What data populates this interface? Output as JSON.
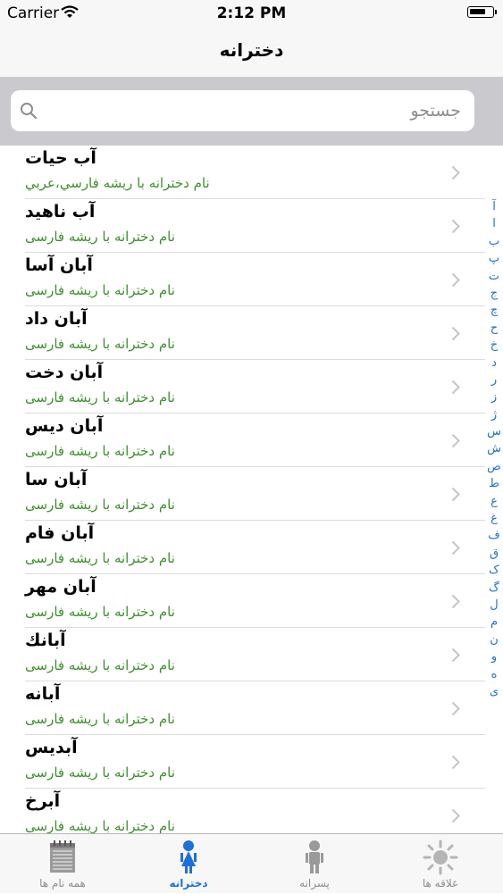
{
  "status": {
    "carrier": "Carrier",
    "time": "2:12 PM"
  },
  "nav": {
    "title": "دخترانه"
  },
  "search": {
    "placeholder": "جستجو"
  },
  "rows": [
    {
      "name": "آب حیات",
      "desc": "نام دخترانه با ریشه فارسي،عربي"
    },
    {
      "name": "آب ناهید",
      "desc": "نام دخترانه با ریشه فارسی"
    },
    {
      "name": "آبان آسا",
      "desc": "نام دخترانه با ریشه فارسی"
    },
    {
      "name": "آبان داد",
      "desc": "نام دخترانه با ریشه فارسی"
    },
    {
      "name": "آبان دخت",
      "desc": "نام دخترانه با ریشه فارسی"
    },
    {
      "name": "آبان دیس",
      "desc": "نام دخترانه با ریشه فارسی"
    },
    {
      "name": "آبان سا",
      "desc": "نام دخترانه با ریشه فارسی"
    },
    {
      "name": "آبان فام",
      "desc": "نام دخترانه با ریشه فارسی"
    },
    {
      "name": "آبان مهر",
      "desc": "نام دخترانه با ریشه فارسی"
    },
    {
      "name": "آبانك",
      "desc": "نام دخترانه با ریشه فارسی"
    },
    {
      "name": "آبانه",
      "desc": "نام دخترانه با ریشه فارسی"
    },
    {
      "name": "آبدیس",
      "desc": "نام دخترانه با ریشه فارسی"
    },
    {
      "name": "آبرخ",
      "desc": "نام دخترانه با ریشه فارسی"
    }
  ],
  "index_letters": [
    "آ",
    "ا",
    "ب",
    "پ",
    "ت",
    "ج",
    "چ",
    "ح",
    "خ",
    "د",
    "ر",
    "ز",
    "ژ",
    "س",
    "ش",
    "ص",
    "ط",
    "ع",
    "غ",
    "ف",
    "ق",
    "ک",
    "گ",
    "ل",
    "م",
    "ن",
    "و",
    "ه",
    "ی"
  ],
  "tabs": [
    {
      "label": "همه نام ها",
      "icon": "notepad-icon"
    },
    {
      "label": "دخترانه",
      "icon": "girl-icon"
    },
    {
      "label": "پسرانه",
      "icon": "boy-icon"
    },
    {
      "label": "علاقه ها",
      "icon": "sun-icon"
    }
  ],
  "colors": {
    "accent": "#1e6fd9",
    "subtitle": "#3f8f2f",
    "search_bg": "#c9c9ce"
  }
}
